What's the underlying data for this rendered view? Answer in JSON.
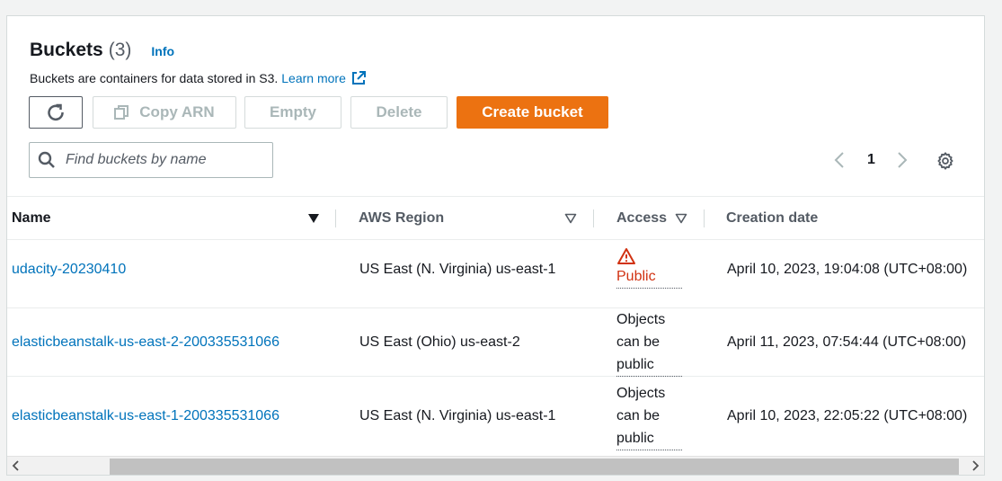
{
  "header": {
    "title": "Buckets",
    "count": "(3)",
    "info": "Info",
    "description": "Buckets are containers for data stored in S3.",
    "learn_more": "Learn more"
  },
  "toolbar": {
    "copy_arn": "Copy ARN",
    "empty": "Empty",
    "delete": "Delete",
    "create": "Create bucket"
  },
  "search": {
    "placeholder": "Find buckets by name",
    "value": ""
  },
  "pagination": {
    "page": "1"
  },
  "columns": {
    "name": "Name",
    "region": "AWS Region",
    "access": "Access",
    "created": "Creation date"
  },
  "rows": [
    {
      "name": "udacity-20230410",
      "region": "US East (N. Virginia) us-east-1",
      "access": "Public",
      "created": "April 10, 2023, 19:04:08 (UTC+08:00)"
    },
    {
      "name": "elasticbeanstalk-us-east-2-200335531066",
      "region": "US East (Ohio) us-east-2",
      "access": "Objects can be public",
      "created": "April 11, 2023, 07:54:44 (UTC+08:00)"
    },
    {
      "name": "elasticbeanstalk-us-east-1-200335531066",
      "region": "US East (N. Virginia) us-east-1",
      "access": "Objects can be public",
      "created": "April 10, 2023, 22:05:22 (UTC+08:00)"
    }
  ],
  "colors": {
    "accent": "#ec7211",
    "link": "#0073bb",
    "warning": "#d13212"
  }
}
